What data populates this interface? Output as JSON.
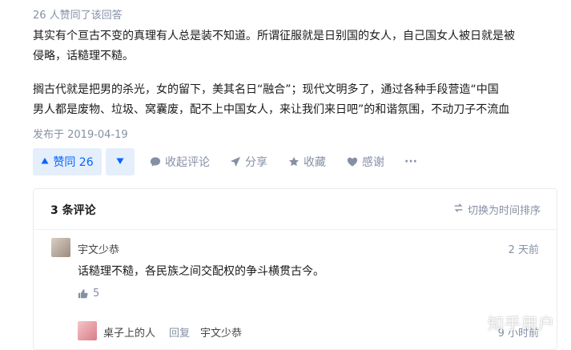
{
  "answer": {
    "voters_text": "26 人赞同了该回答",
    "paragraph1_line1": "其实有个亘古不变的真理有人总是装不知道。所谓征服就是日别国的女人，自己国女人被日就是被",
    "paragraph1_line2": "侵略，话糙理不糙。",
    "paragraph2_line1": "搁古代就是把男的杀光，女的留下，美其名日“融合”；现代文明多了，通过各种手段营造“中国",
    "paragraph2_line2": "男人都是废物、垃圾、窝囊废，配不上中国女人，来让我们来日吧”的和谐氛围，不动刀子不流血",
    "published": "发布于 2019-04-19"
  },
  "actions": {
    "vote_label": "赞同 26",
    "collapse_comments": "收起评论",
    "share": "分享",
    "favorite": "收藏",
    "thanks": "感谢",
    "more": "···"
  },
  "comments": {
    "title": "3 条评论",
    "sort_label": "切换为时间排序",
    "items": [
      {
        "author": "宇文少恭",
        "time": "2 天前",
        "text": "话糙理不糙，各民族之间交配权的争斗横贯古今。",
        "likes": "5"
      },
      {
        "author": "桌子上的人",
        "reply_label": "回复",
        "reply_to": "宇文少恭",
        "time": "9 小时前"
      }
    ]
  },
  "watermark": "知乎用户",
  "colors": {
    "accent": "#0066ff",
    "muted": "#8590a6",
    "vote_bg": "#e5eefb"
  }
}
